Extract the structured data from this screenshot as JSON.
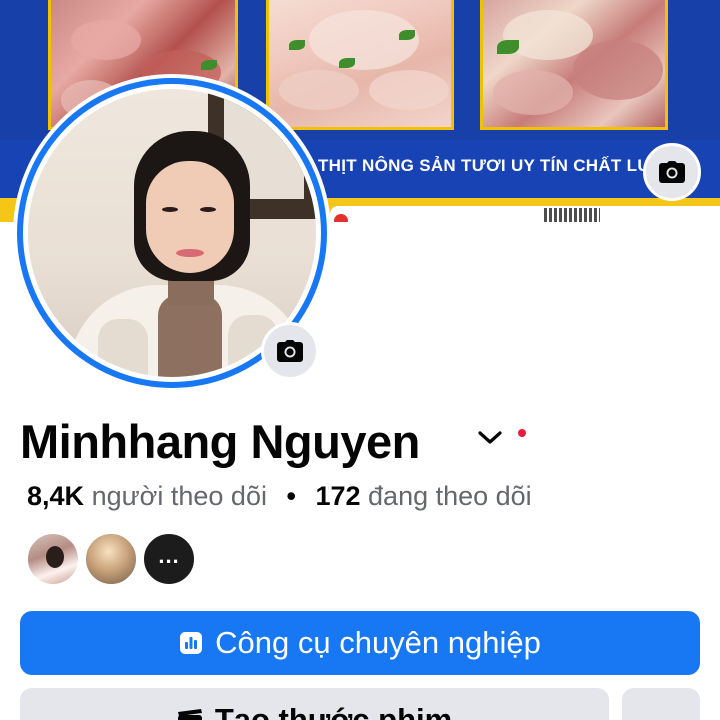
{
  "cover": {
    "banner_text": "THỊT NÔNG SẢN TƯƠI UY TÍN CHẤT LƯỢNG"
  },
  "profile": {
    "name": "Minhhang Nguyen"
  },
  "stats": {
    "followers_count": "8,4K",
    "followers_label": "người theo dõi",
    "separator": "•",
    "following_count": "172",
    "following_label": "đang theo dõi"
  },
  "followers_preview": {
    "more_label": "..."
  },
  "actions": {
    "professional_tools_label": "Công cụ chuyên nghiệp",
    "create_reel_label": "Tạo thước phim",
    "more_label": "..."
  },
  "icons": {
    "cover_camera": "camera-icon",
    "avatar_camera": "camera-icon",
    "dropdown": "chevron-down-icon",
    "pro_tools": "bar-chart-icon",
    "reel": "clapperboard-icon",
    "more": "more-horizontal-icon"
  },
  "colors": {
    "primary_blue": "#1877f2",
    "secondary_button": "#e4e6eb",
    "notification_red": "#e41e3f",
    "cover_blue": "#1740a8",
    "cover_yellow": "#f4c617"
  }
}
